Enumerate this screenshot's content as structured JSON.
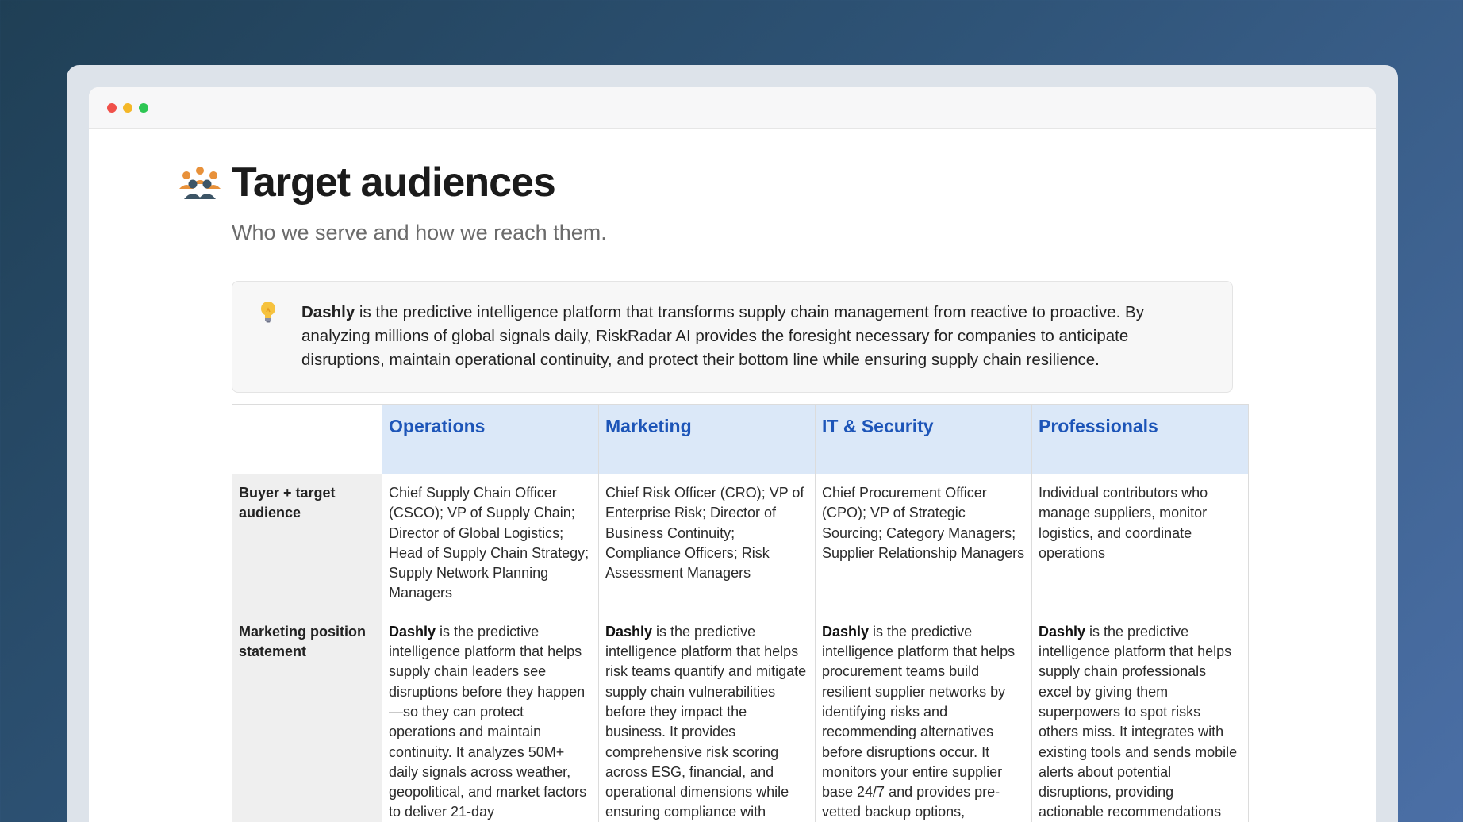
{
  "page": {
    "title": "Target audiences",
    "subtitle": "Who we serve and how we reach them."
  },
  "callout": {
    "brand": "Dashly",
    "text": " is the predictive intelligence platform that transforms supply chain management from reactive to proactive. By analyzing millions of global signals daily, RiskRadar AI provides the foresight necessary for companies to anticipate disruptions, maintain operational continuity, and protect their bottom line while ensuring supply chain resilience."
  },
  "table": {
    "columns": [
      "Operations",
      "Marketing",
      "IT & Security",
      "Professionals"
    ],
    "rows": [
      {
        "label": "Buyer + target audience",
        "cells": [
          {
            "brand": "",
            "text": "Chief Supply Chain Officer (CSCO); VP of Supply Chain; Director of Global Logistics; Head of Supply Chain Strategy; Supply Network Planning Managers"
          },
          {
            "brand": "",
            "text": "Chief Risk Officer (CRO); VP of Enterprise Risk; Director of Business Continuity; Compliance Officers; Risk Assessment Managers"
          },
          {
            "brand": "",
            "text": "Chief Procurement Officer (CPO); VP of Strategic Sourcing; Category Managers; Supplier Relationship Managers"
          },
          {
            "brand": "",
            "text": "Individual contributors who manage suppliers, monitor logistics, and coordinate operations"
          }
        ]
      },
      {
        "label": "Marketing position statement",
        "cells": [
          {
            "brand": "Dashly",
            "text": " is the predictive intelligence platform that helps supply chain leaders see disruptions before they happen—so they can protect operations and maintain continuity. It analyzes 50M+ daily signals across weather, geopolitical, and market factors to deliver 21-day"
          },
          {
            "brand": "Dashly",
            "text": " is the predictive intelligence platform that helps risk teams quantify and mitigate supply chain vulnerabilities before they impact the business. It provides comprehensive risk scoring across ESG, financial, and operational dimensions while ensuring compliance with"
          },
          {
            "brand": "Dashly",
            "text": " is the predictive intelligence platform that helps procurement teams build resilient supplier networks by identifying risks and recommending alternatives before disruptions occur. It monitors your entire supplier base 24/7 and provides pre-vetted backup options,"
          },
          {
            "brand": "Dashly",
            "text": " is the predictive intelligence platform that helps supply chain professionals excel by giving them superpowers to spot risks others miss. It integrates with existing tools and sends mobile alerts about potential disruptions, providing actionable recommendations"
          }
        ]
      }
    ]
  },
  "icons": {
    "title_icon": "people-group-icon",
    "callout_icon": "lightbulb-icon"
  },
  "colors": {
    "header_bg": "#dbe8f8",
    "header_text": "#1d55b8",
    "row_head_bg": "#efefef"
  }
}
